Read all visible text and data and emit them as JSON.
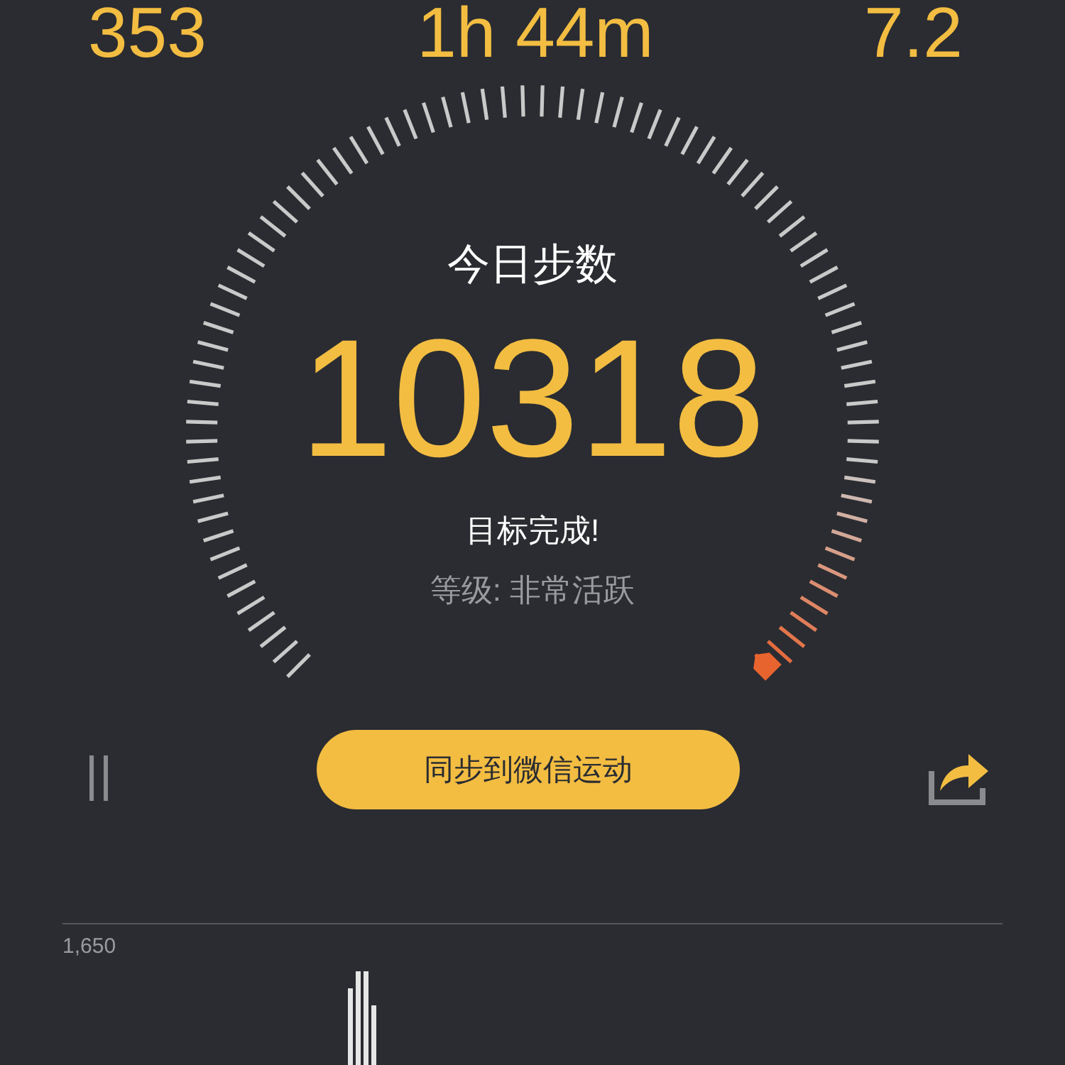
{
  "stats": [
    "353",
    "1h 44m",
    "7.2"
  ],
  "gauge": {
    "title": "今日步数",
    "steps": "10318",
    "status": "目标完成!",
    "grade": "等级: 非常活跃"
  },
  "sync_button": "同步到微信运动",
  "chart": {
    "max_label": "1,650"
  }
}
